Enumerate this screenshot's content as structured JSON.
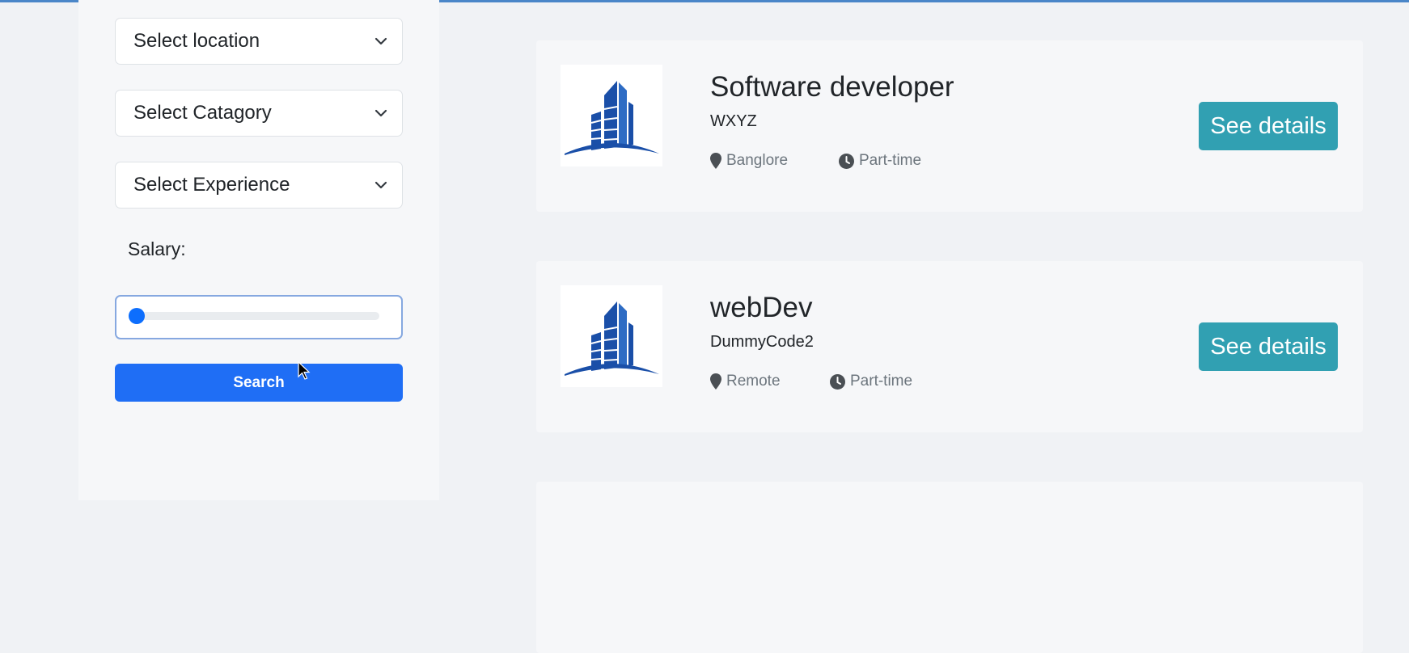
{
  "filters": {
    "location": "Select location",
    "category": "Select Catagory",
    "experience": "Select Experience",
    "salary_label": "Salary:",
    "salary_value_fraction": 0.0,
    "search_label": "Search"
  },
  "jobs": [
    {
      "title": "Software developer",
      "company": "WXYZ",
      "location": "Banglore",
      "type": "Part-time",
      "button": "See details"
    },
    {
      "title": "webDev",
      "company": "DummyCode2",
      "location": "Remote",
      "type": "Part-time",
      "button": "See details"
    }
  ],
  "colors": {
    "primary": "#1f6ef5",
    "details_button": "#31a0b2",
    "logo_blue": "#1a4fa8"
  },
  "icons": [
    "chevron-down-icon",
    "map-pin-icon",
    "clock-icon",
    "building-logo-icon",
    "mouse-cursor-icon"
  ]
}
